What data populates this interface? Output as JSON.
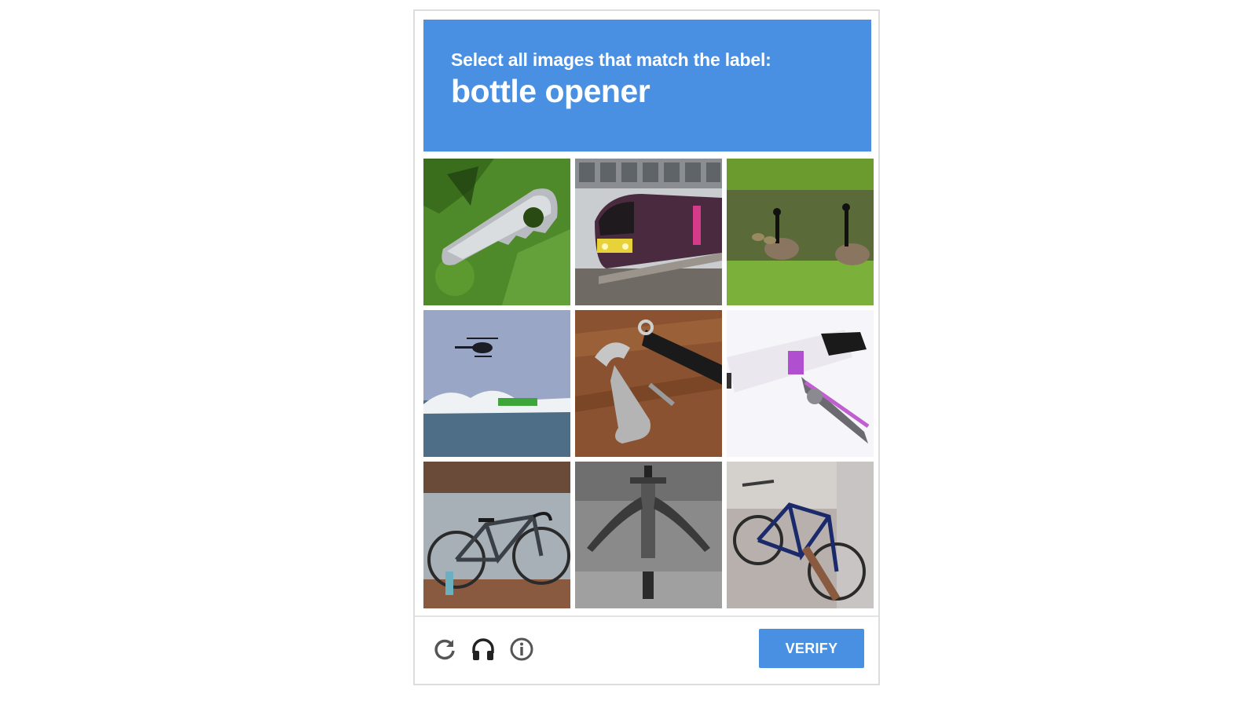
{
  "header": {
    "instruction": "Select all images that match the label:",
    "label": "bottle opener",
    "background_color": "#4a90e2"
  },
  "tiles": [
    {
      "name": "tile-bottle-opener-keychain",
      "subject": "steel bottle opener on green towel"
    },
    {
      "name": "tile-train",
      "subject": "purple passenger train at station"
    },
    {
      "name": "tile-geese",
      "subject": "canada geese by pond"
    },
    {
      "name": "tile-helicopter",
      "subject": "helicopter over ocean spray"
    },
    {
      "name": "tile-waiter-corkscrew",
      "subject": "waiter's corkscrew on wood"
    },
    {
      "name": "tile-wine-opener-device",
      "subject": "lever wine opener with purple band"
    },
    {
      "name": "tile-road-bike",
      "subject": "road bicycle on pavement"
    },
    {
      "name": "tile-winged-corkscrew",
      "subject": "winged corkscrew black and white"
    },
    {
      "name": "tile-bikes-parked",
      "subject": "bicycles parked against wall"
    }
  ],
  "footer": {
    "icons": [
      "refresh-icon",
      "headphones-icon",
      "info-icon"
    ],
    "verify_label": "VERIFY",
    "accent_color": "#4a90e2"
  }
}
